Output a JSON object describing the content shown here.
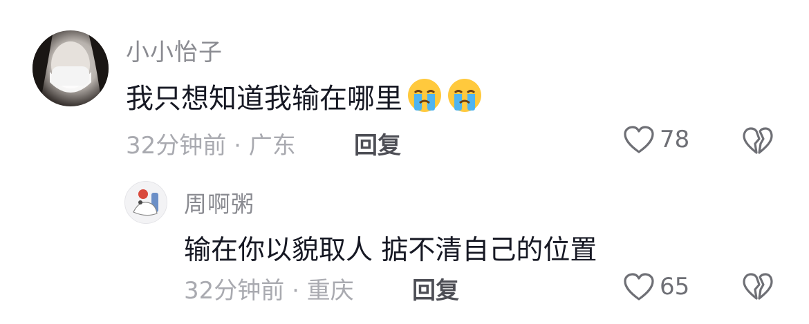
{
  "comments": [
    {
      "username": "小小怡子",
      "text": "我只想知道我输在哪里",
      "emojis": [
        "crying-face-icon",
        "crying-face-icon"
      ],
      "time": "32分钟前",
      "location": "广东",
      "reply_label": "回复",
      "likes": "78"
    },
    {
      "username": "周啊粥",
      "text": "输在你以貌取人  掂不清自己的位置",
      "time": "32分钟前",
      "location": "重庆",
      "reply_label": "回复",
      "likes": "65"
    }
  ],
  "colors": {
    "username": "#8a8b91",
    "meta": "#a9aab0",
    "text": "#161823"
  }
}
